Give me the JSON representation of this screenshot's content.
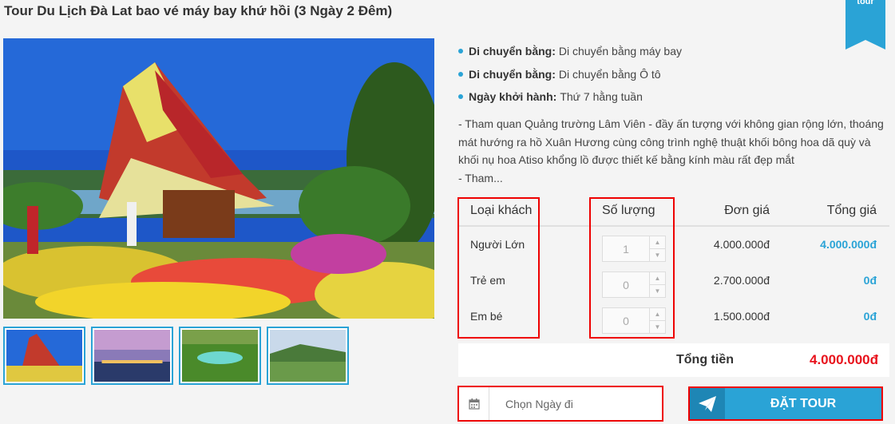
{
  "title": "Tour Du Lịch Đà Lat bao vé máy bay khứ hồi (3 Ngày 2 Đêm)",
  "ribbon": "tour",
  "info": [
    {
      "label": "Di chuyển bằng:",
      "value": "Di chuyển bằng máy bay"
    },
    {
      "label": "Di chuyển bằng:",
      "value": "Di chuyển bằng Ô tô"
    },
    {
      "label": "Ngày khởi hành:",
      "value": "Thứ 7 hằng tuần"
    }
  ],
  "description": {
    "line1": "- Tham quan Quảng trường Lâm Viên - đầy ấn tượng với không gian rộng lớn, thoáng",
    "line2": "mát hướng ra hồ Xuân Hương cùng công trình nghệ thuật khối bông hoa dã quỳ và",
    "line3": "khối nụ hoa Atiso khổng lồ được thiết kế bằng kính màu rất đẹp mắt",
    "line4": "- Tham..."
  },
  "table": {
    "headers": {
      "type": "Loại khách",
      "qty": "Số lượng",
      "unit": "Đơn giá",
      "total": "Tổng giá"
    },
    "rows": [
      {
        "type": "Người Lớn",
        "qty": "1",
        "unit": "4.000.000đ",
        "total": "4.000.000đ"
      },
      {
        "type": "Trẻ em",
        "qty": "0",
        "unit": "2.700.000đ",
        "total": "0đ"
      },
      {
        "type": "Em bé",
        "qty": "0",
        "unit": "1.500.000đ",
        "total": "0đ"
      }
    ]
  },
  "summary": {
    "label": "Tổng tiền",
    "amount": "4.000.000đ"
  },
  "date_field": {
    "placeholder": "Chọn Ngày đi"
  },
  "book_button": {
    "label": "ĐẶT TOUR"
  },
  "colors": {
    "accent": "#2aa3d6",
    "total_red": "#e8121c",
    "highlight_box": "#ee0000"
  },
  "icons": {
    "date": "calendar-icon",
    "book": "paper-plane-icon",
    "stepper_up": "chevron-up-icon",
    "stepper_down": "chevron-down-icon"
  }
}
